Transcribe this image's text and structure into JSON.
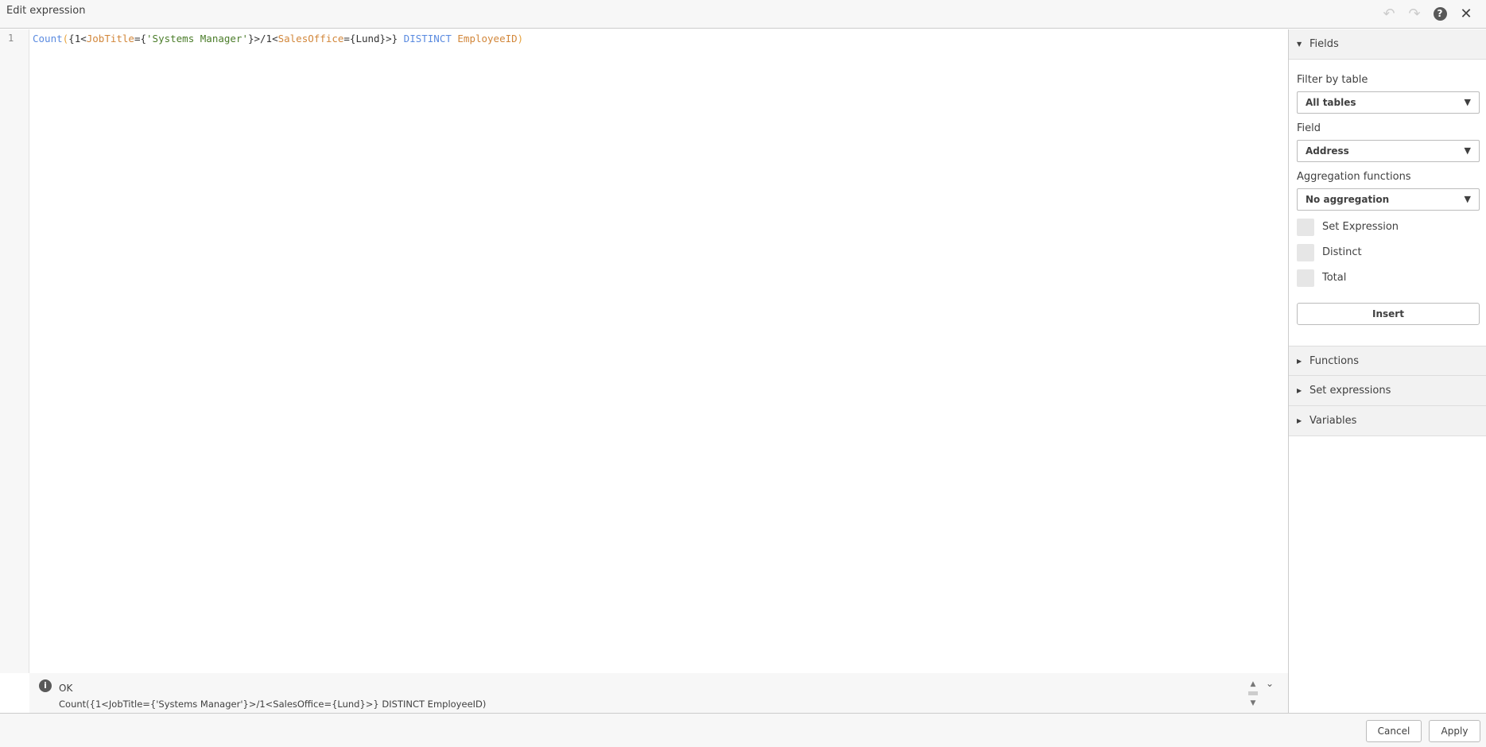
{
  "header": {
    "title": "Edit expression",
    "undo_icon": "undo-icon",
    "redo_icon": "redo-icon",
    "help_icon": "help-icon",
    "close_icon": "close-icon"
  },
  "editor": {
    "line_number": "1",
    "tokens": [
      {
        "t": "Count",
        "c": "kw"
      },
      {
        "t": "(",
        "c": "br"
      },
      {
        "t": "{1<",
        "c": ""
      },
      {
        "t": "JobTitle",
        "c": "fd"
      },
      {
        "t": "={",
        "c": ""
      },
      {
        "t": "'Systems Manager'",
        "c": "st"
      },
      {
        "t": "}>/1<",
        "c": ""
      },
      {
        "t": "SalesOffice",
        "c": "fd"
      },
      {
        "t": "={Lund}>}",
        "c": ""
      },
      {
        "t": " DISTINCT ",
        "c": "kw"
      },
      {
        "t": "EmployeeID",
        "c": "fd"
      },
      {
        "t": ")",
        "c": "br"
      }
    ]
  },
  "status": {
    "state": "OK",
    "message": "Count({1<JobTitle={'Systems Manager'}>/1<SalesOffice={Lund}>} DISTINCT EmployeeID)"
  },
  "panel": {
    "fields_header": "Fields",
    "filter_label": "Filter by table",
    "filter_value": "All tables",
    "field_label": "Field",
    "field_value": "Address",
    "agg_label": "Aggregation functions",
    "agg_value": "No aggregation",
    "cb_set": "Set Expression",
    "cb_distinct": "Distinct",
    "cb_total": "Total",
    "insert": "Insert",
    "functions": "Functions",
    "set_expressions": "Set expressions",
    "variables": "Variables"
  },
  "footer": {
    "cancel": "Cancel",
    "apply": "Apply"
  }
}
